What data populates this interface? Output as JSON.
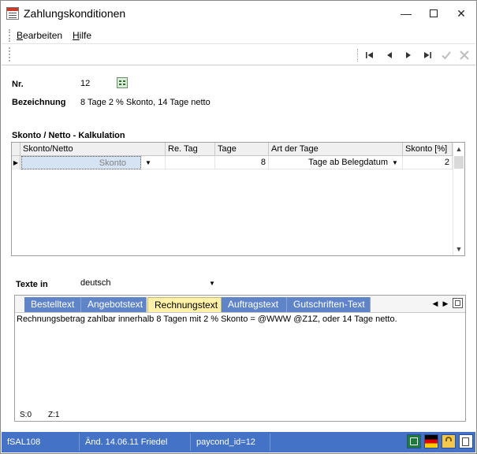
{
  "window": {
    "title": "Zahlungskonditionen",
    "controls": {
      "minimize": "—",
      "maximize": "",
      "close": "✕"
    }
  },
  "menu": {
    "edit": {
      "accel": "B",
      "rest": "earbeiten"
    },
    "help": {
      "accel": "H",
      "rest": "ilfe"
    }
  },
  "toolbar": {
    "buttons": [
      "first-record-icon",
      "previous-record-icon",
      "next-record-icon",
      "last-record-icon",
      "confirm-icon",
      "cancel-icon"
    ]
  },
  "form": {
    "nr_label": "Nr.",
    "nr_value": "12",
    "bezeichnung_label": "Bezeichnung",
    "bezeichnung_value": "8 Tage 2 % Skonto, 14 Tage netto"
  },
  "grid": {
    "title": "Skonto / Netto - Kalkulation",
    "columns": [
      "Skonto/Netto",
      "Re. Tag",
      "Tage",
      "Art der Tage",
      "Skonto [%]"
    ],
    "rows": [
      {
        "skonto_netto": "Skonto",
        "re_tag": "",
        "tage": "8",
        "art_der_tage": "Tage ab Belegdatum",
        "skonto_pct": "2"
      }
    ]
  },
  "texte": {
    "label": "Texte in",
    "language": "deutsch",
    "tabs": [
      "Bestelltext",
      "Angebotstext",
      "Rechnungstext",
      "Auftragstext",
      "Gutschriften-Text"
    ],
    "active_tab": "Rechnungstext",
    "body": "Rechnungsbetrag zahlbar innerhalb 8 Tagen mit 2 %  Skonto = @WWW @Z1Z, oder 14 Tage netto.",
    "status_s": "S:0",
    "status_z": "Z:1"
  },
  "statusbar": {
    "form_id": "fSAL108",
    "changed": "Änd. 14.06.11 Friedel",
    "record": "paycond_id=12",
    "icons": [
      "excel-export-icon",
      "german-flag-icon",
      "lock-icon",
      "document-icon"
    ]
  },
  "colors": {
    "statusbar_bg": "#4472c4",
    "tab_bg": "#5f85c8",
    "tab_active_bg": "#fff2a8",
    "selected_cell_bg": "#d6e3f5"
  }
}
